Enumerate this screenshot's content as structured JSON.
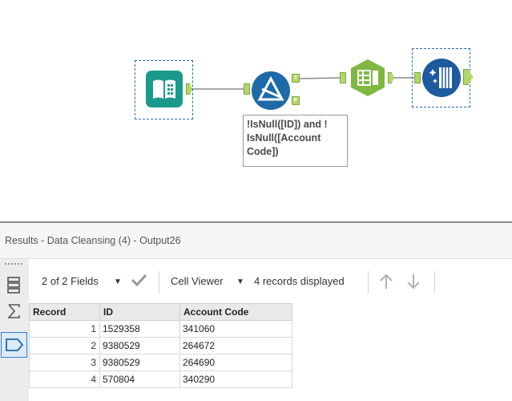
{
  "workflow": {
    "filter_annotation": "!IsNull([ID]) and ! IsNull([Account Code])",
    "anchor_true": "T",
    "anchor_false": "F",
    "colors": {
      "input": "#1a9a8a",
      "filter": "#1e6aa8",
      "select": "#7fb741",
      "output": "#1e5aa0",
      "anchor": "#b3d66b"
    }
  },
  "results": {
    "title": "Results - Data Cleansing (4) - Output26",
    "toolbar": {
      "fields_label": "2 of 2 Fields",
      "cell_viewer_label": "Cell Viewer",
      "records_label": "4 records displayed"
    },
    "table": {
      "headers": [
        "Record",
        "ID",
        "Account Code"
      ],
      "rows": [
        [
          "1",
          "1529358",
          "341060"
        ],
        [
          "2",
          "9380529",
          "264672"
        ],
        [
          "3",
          "9380529",
          "264690"
        ],
        [
          "4",
          "570804",
          "340290"
        ]
      ]
    }
  }
}
